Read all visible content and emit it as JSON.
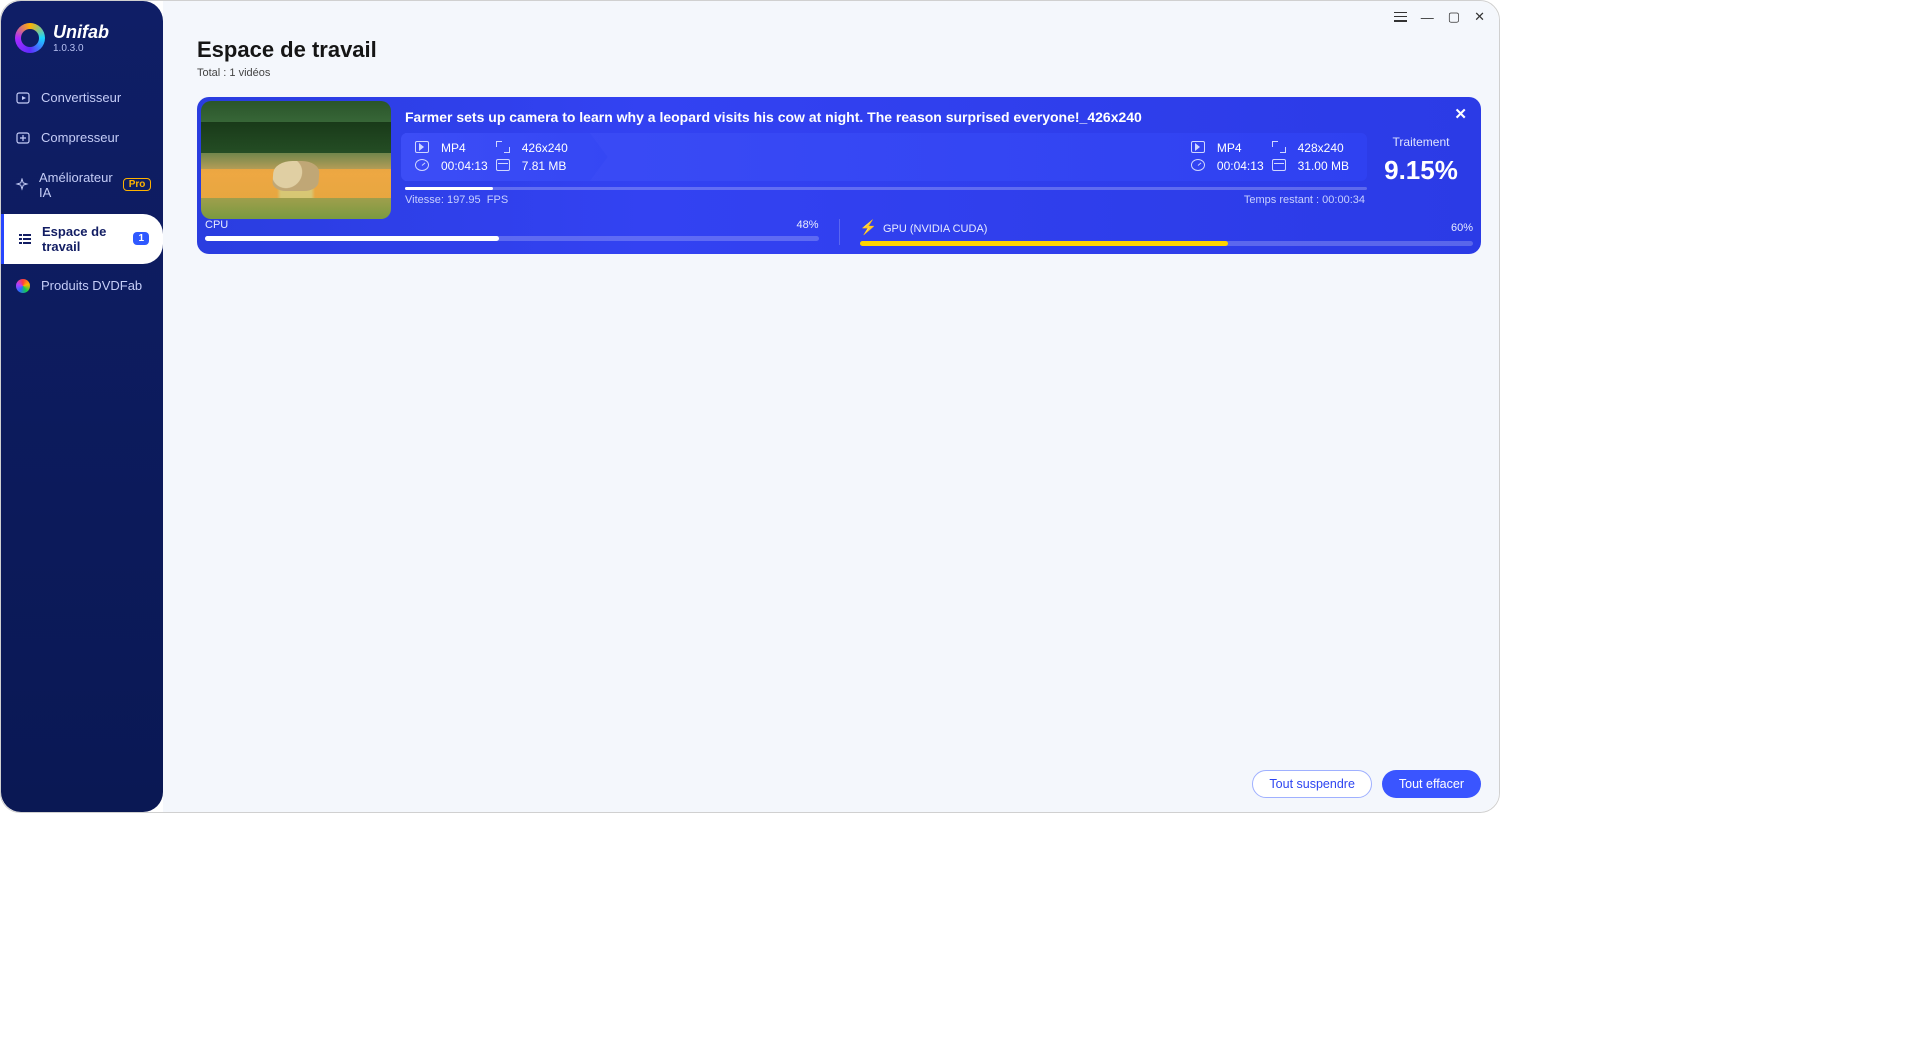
{
  "brand": {
    "name": "Unifab",
    "version": "1.0.3.0"
  },
  "sidebar": {
    "items": [
      {
        "label": "Convertisseur"
      },
      {
        "label": "Compresseur"
      },
      {
        "label": "Améliorateur IA",
        "pro": "Pro"
      },
      {
        "label": "Espace de travail",
        "count": "1"
      },
      {
        "label": "Produits DVDFab"
      }
    ]
  },
  "header": {
    "title": "Espace de travail",
    "subtitle": "Total : 1 vidéos"
  },
  "task": {
    "title": "Farmer sets up camera to learn why a leopard visits his cow at night. The reason surprised everyone!_426x240",
    "src": {
      "format": "MP4",
      "resolution": "426x240",
      "duration": "00:04:13",
      "size": "7.81 MB"
    },
    "dst": {
      "format": "MP4",
      "resolution": "428x240",
      "duration": "00:04:13",
      "size": "31.00 MB"
    },
    "progress_percent": 9.15,
    "speed_label": "Vitesse:",
    "speed_value": "197.95",
    "speed_unit": "FPS",
    "remaining_label": "Temps restant :",
    "remaining_value": "00:00:34",
    "status_label": "Traitement",
    "status_value": "9.15%",
    "cpu_label": "CPU",
    "cpu_value": "48%",
    "cpu_percent": 48,
    "gpu_label": "GPU (NVIDIA CUDA)",
    "gpu_value": "60%",
    "gpu_percent": 60
  },
  "footer": {
    "suspend": "Tout suspendre",
    "clear": "Tout effacer"
  }
}
